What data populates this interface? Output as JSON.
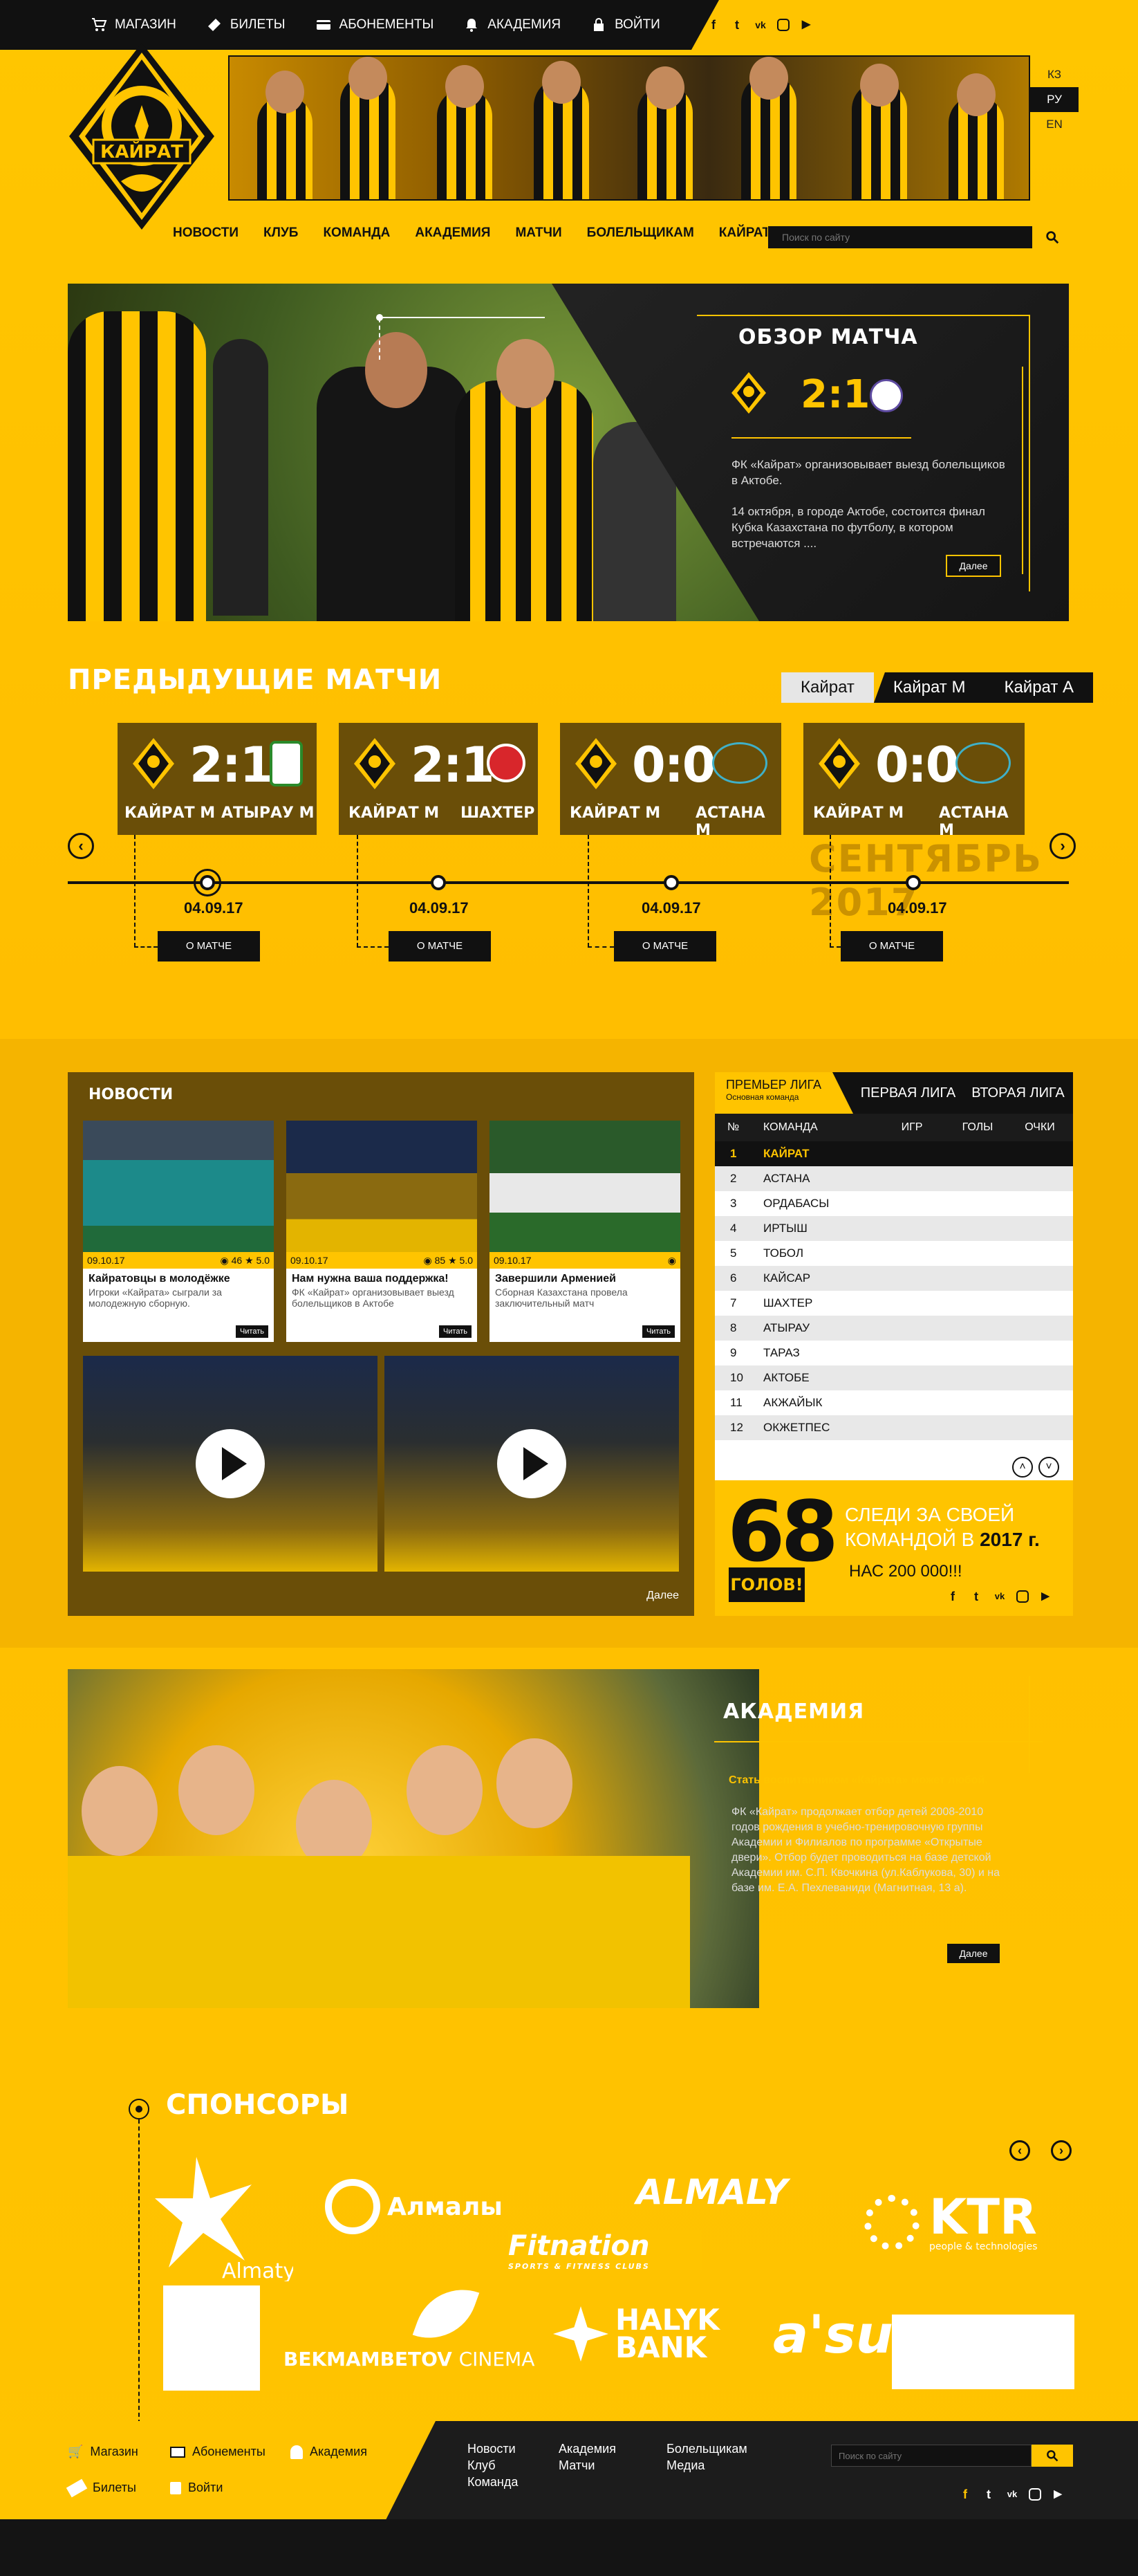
{
  "topbar": {
    "items": [
      {
        "label": "МАГАЗИН",
        "icon": "cart-icon"
      },
      {
        "label": "БИЛЕТЫ",
        "icon": "ticket-icon"
      },
      {
        "label": "АБОНЕМЕНТЫ",
        "icon": "card-icon"
      },
      {
        "label": "АКАДЕМИЯ",
        "icon": "bell-icon"
      },
      {
        "label": "ВОЙТИ",
        "icon": "lock-icon"
      }
    ],
    "social": [
      "f",
      "t",
      "vk",
      "ig",
      "yt"
    ]
  },
  "logo_text": "КАЙРАТ",
  "languages": [
    "КЗ",
    "РУ",
    "EN"
  ],
  "active_language": "РУ",
  "main_nav": [
    "НОВОСТИ",
    "КЛУБ",
    "КОМАНДА",
    "АКАДЕМИЯ",
    "МАТЧИ",
    "БОЛЕЛЬЩИКАМ",
    "КАЙРАТ TV"
  ],
  "search": {
    "placeholder": "Поиск по сайту"
  },
  "hero": {
    "title": "ОБЗОР МАТЧА",
    "score": "2:1",
    "lead": "ФК «Кайрат» организовывает выезд болельщиков в Актобе.",
    "text": "14 октября, в городе Актобе, состоится финал Кубка Казахстана по футболу, в котором встречаются ....",
    "button": "Далее"
  },
  "previous": {
    "title": "ПРЕДЫДУЩИЕ МАТЧИ",
    "tabs": [
      "Кайрат",
      "Кайрат М",
      "Кайрат А"
    ],
    "month": "СЕНТЯБРЬ 2017",
    "matches": [
      {
        "score": "2:1",
        "home": "КАЙРАТ М",
        "away": "АТЫРАУ М",
        "date": "04.09.17",
        "button": "О МАТЧЕ"
      },
      {
        "score": "2:1",
        "home": "КАЙРАТ М",
        "away": "ШАХТЕР",
        "date": "04.09.17",
        "button": "О МАТЧЕ"
      },
      {
        "score": "0:0",
        "home": "КАЙРАТ М",
        "away": "АСТАНА М",
        "date": "04.09.17",
        "button": "О МАТЧЕ"
      },
      {
        "score": "0:0",
        "home": "КАЙРАТ М",
        "away": "АСТАНА М",
        "date": "04.09.17",
        "button": "О МАТЧЕ"
      }
    ]
  },
  "news": {
    "title": "НОВОСТИ",
    "more": "Далее",
    "read": "Читать",
    "items": [
      {
        "date": "09.10.17",
        "views": "46",
        "rating": "5.0",
        "title": "Кайратовцы в молодёжке",
        "text": "Игроки «Кайрата» сыграли за молодежную сборную."
      },
      {
        "date": "09.10.17",
        "views": "85",
        "rating": "5.0",
        "title": "Нам нужна ваша поддержка!",
        "text": "ФК «Кайрат» организовывает выезд болельщиков в Актобе"
      },
      {
        "date": "09.10.17",
        "views": "",
        "rating": "",
        "title": "Завершили Арменией",
        "text": "Сборная Казахстана провела заключительный матч"
      }
    ]
  },
  "league": {
    "tabs": [
      {
        "label": "ПРЕМЬЕР ЛИГА",
        "sub": "Основная команда"
      },
      {
        "label": "ПЕРВАЯ ЛИГА"
      },
      {
        "label": "ВТОРАЯ ЛИГА"
      }
    ],
    "columns": [
      "№",
      "КОМАНДА",
      "ИГР",
      "ГОЛЫ",
      "ОЧКИ"
    ],
    "rows": [
      {
        "n": "1",
        "team": "КАЙРАТ"
      },
      {
        "n": "2",
        "team": "АСТАНА"
      },
      {
        "n": "3",
        "team": "ОРДАБАСЫ"
      },
      {
        "n": "4",
        "team": "ИРТЫШ"
      },
      {
        "n": "5",
        "team": "ТОБОЛ"
      },
      {
        "n": "6",
        "team": "КАЙСАР"
      },
      {
        "n": "7",
        "team": "ШАХТЕР"
      },
      {
        "n": "8",
        "team": "АТЫРАУ"
      },
      {
        "n": "9",
        "team": "ТАРАЗ"
      },
      {
        "n": "10",
        "team": "АКТОБЕ"
      },
      {
        "n": "11",
        "team": "АКЖАЙЫК"
      },
      {
        "n": "12",
        "team": "ОКЖЕТПЕС"
      }
    ],
    "goals_number": "68",
    "goals_label": "ГОЛОВ!",
    "follow_text_1": "СЛЕДИ ЗА СВОЕЙ",
    "follow_text_2": "КОМАНДОЙ В",
    "follow_year": "2017 г.",
    "followers": "НАС 200 000!!!"
  },
  "academy": {
    "title": "АКАДЕМИЯ",
    "lead": "Стать воспитанником «Кайрата» может любой.",
    "text": "ФК «Кайрат» продолжает отбор детей 2008-2010 годов рождения в учебно-тренировочную группы Академии и Филиалов по программе «Открытые двери». Отбор будет проводиться на базе детской Академии им. С.П. Квочкина (ул.Каблукова, 30) и на базе им. Е.А. Пехлеваниди (Магнитная, 13 а).",
    "button": "Далее"
  },
  "sponsors": {
    "title": "СПОНСОРЫ",
    "logos": [
      "Almaty",
      "Алмалы",
      "ALMALY",
      "KTR",
      "people & technologies",
      "Fitnation",
      "SPORTS & FITNESS CLUBS",
      "BEKMAMBETOV",
      "CINEMA",
      "HALYK",
      "BANK",
      "a'su"
    ]
  },
  "footer": {
    "quick": [
      "Магазин",
      "Абонементы",
      "Академия",
      "Билеты",
      "Войти"
    ],
    "col1": [
      "Новости",
      "Клуб",
      "Команда"
    ],
    "col2": [
      "Академия",
      "Матчи"
    ],
    "col3": [
      "Болельщикам",
      "Медиа"
    ],
    "search_placeholder": "Поиск по сайту"
  },
  "colors": {
    "accent": "#ffc400",
    "dark": "#111111",
    "brown": "#6a4e08"
  }
}
